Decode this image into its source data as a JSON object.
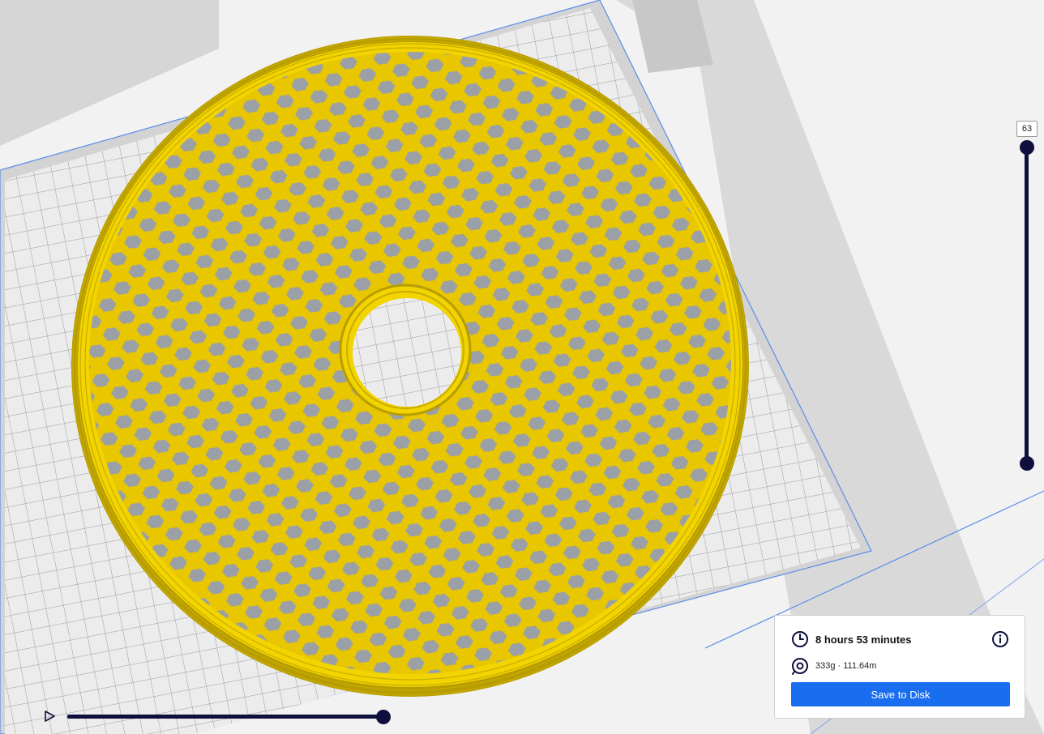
{
  "viewport": {
    "background_color": "#f2f2f2",
    "build_plate_color": "#e3e3e3",
    "grid_color": "#9c9c9c",
    "plate_border_color": "#5a8ee8",
    "model_color": "#f2d400",
    "model_dark_color": "#b89d00",
    "hole_color": "#9aa0a6"
  },
  "layer_slider": {
    "current_layer": "63",
    "accent_color": "#0e0f3d"
  },
  "simulation": {
    "play_icon": "play-icon",
    "progress": 1.0
  },
  "print_info": {
    "time_icon": "clock-icon",
    "print_time": "8 hours 53 minutes",
    "info_icon": "info-icon",
    "material_icon": "spool-icon",
    "material_usage": "333g · 111.64m",
    "save_label": "Save to Disk",
    "button_color": "#196ef0"
  }
}
